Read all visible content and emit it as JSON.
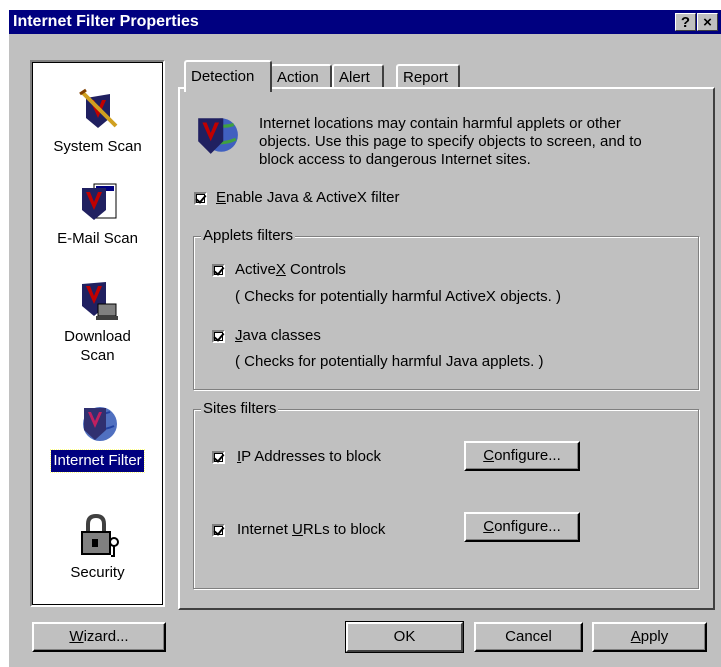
{
  "window": {
    "title": "Internet Filter Properties",
    "help_btn": "?",
    "close_btn": "×"
  },
  "sidebar": {
    "items": [
      {
        "label": "System Scan",
        "icon": "system-scan-icon"
      },
      {
        "label": "E-Mail Scan",
        "icon": "email-scan-icon"
      },
      {
        "label": "Download Scan",
        "line1": "Download",
        "line2": "Scan",
        "icon": "download-scan-icon"
      },
      {
        "label": "Internet Filter",
        "icon": "internet-filter-icon",
        "selected": true
      },
      {
        "label": "Security",
        "icon": "security-lock-icon"
      }
    ]
  },
  "tabs": [
    {
      "label": "Detection",
      "active": true
    },
    {
      "label": "Action"
    },
    {
      "label": "Alert"
    },
    {
      "label": "Report"
    }
  ],
  "detection": {
    "description": "Internet locations may contain harmful applets or other objects. Use this page to specify objects to screen, and to block access to dangerous Internet sites.",
    "desc_lines": [
      "Internet locations may contain harmful applets or other",
      "objects. Use this page to specify objects to screen, and to",
      "block access to dangerous Internet sites."
    ],
    "enable_filter": {
      "label_pre": "",
      "label_u": "E",
      "label_post": "nable Java & ActiveX filter",
      "checked": true
    },
    "applets_group": {
      "title": "Applets filters",
      "activex": {
        "label_pre": "Active",
        "label_u": "X",
        "label_post": " Controls",
        "note": "( Checks for potentially harmful ActiveX objects. )",
        "checked": true
      },
      "java": {
        "label_pre": "",
        "label_u": "J",
        "label_post": "ava classes",
        "note": "( Checks for potentially harmful Java applets. )",
        "checked": true
      }
    },
    "sites_group": {
      "title": "Sites filters",
      "ip": {
        "label_pre": "",
        "label_u": "I",
        "label_post": "P Addresses to block",
        "checked": true,
        "button_u": "C",
        "button_post": "onfigure..."
      },
      "urls": {
        "label_pre": "Internet ",
        "label_u": "U",
        "label_post": "RLs to block",
        "checked": true,
        "button_u": "C",
        "button_post": "onfigure..."
      }
    }
  },
  "footer": {
    "wizard_u": "W",
    "wizard_post": "izard...",
    "ok": "OK",
    "cancel": "Cancel",
    "apply_u": "A",
    "apply_post": "pply"
  },
  "colors": {
    "titlebar": "#000080",
    "face": "#c0c0c0",
    "selection": "#000080",
    "logo_red": "#c00000"
  }
}
